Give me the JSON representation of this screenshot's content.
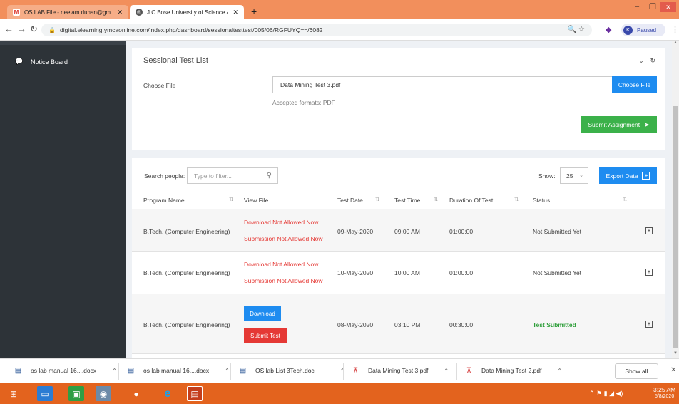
{
  "browser": {
    "tabs": [
      {
        "label": "OS LAB File - neelam.duhan@gm",
        "active": false
      },
      {
        "label": "J.C Bose University of Science &",
        "active": true
      }
    ],
    "url": "digital.elearning.ymcaonline.com/index.php/dashboard/sessionaltesttest/005/06/RGFUYQ==/6082",
    "profile_label": "Paused",
    "profile_initial": "K"
  },
  "sidebar": {
    "items": [
      {
        "label": "Notice Board",
        "icon": "chat-bubble-icon"
      }
    ]
  },
  "page": {
    "title": "Sessional Test List",
    "choose_file_label": "Choose File",
    "file_value": "Data Mining Test 3.pdf",
    "choose_file_button": "Choose File",
    "accepted_formats": "Accepted formats: PDF",
    "submit_assignment": "Submit Assignment"
  },
  "table": {
    "search_label": "Search people:",
    "search_placeholder": "Type to filter...",
    "show_label": "Show:",
    "page_size": "25",
    "export_label": "Export Data",
    "headers": [
      "Program Name",
      "View File",
      "Test Date",
      "Test Time",
      "Duration Of Test",
      "Status"
    ],
    "rows": [
      {
        "program": "B.Tech. (Computer Engineering)",
        "link1": "Download Not Allowed Now",
        "link2": "Submission Not Allowed Now",
        "date": "09-May-2020",
        "time": "09:00 AM",
        "duration": "01:00:00",
        "status": "Not Submitted Yet"
      },
      {
        "program": "B.Tech. (Computer Engineering)",
        "link1": "Download Not Allowed Now",
        "link2": "Submission Not Allowed Now",
        "date": "10-May-2020",
        "time": "10:00 AM",
        "duration": "01:00:00",
        "status": "Not Submitted Yet"
      },
      {
        "program": "B.Tech. (Computer Engineering)",
        "btn1": "Download",
        "btn2": "Submit Test",
        "date": "08-May-2020",
        "time": "03:10 PM",
        "duration": "00:30:00",
        "status": "Test Submitted"
      }
    ]
  },
  "downloads": [
    {
      "label": "os lab manual 16....docx",
      "type": "word"
    },
    {
      "label": "os lab manual 16....docx",
      "type": "word"
    },
    {
      "label": "OS lab List 3Tech.doc",
      "type": "word"
    },
    {
      "label": "Data Mining Test 3.pdf",
      "type": "pdf"
    },
    {
      "label": "Data Mining Test 2.pdf",
      "type": "pdf"
    }
  ],
  "downloads_show_all": "Show all",
  "taskbar": {
    "time": "3:25 AM",
    "date": "5/8/2020"
  }
}
